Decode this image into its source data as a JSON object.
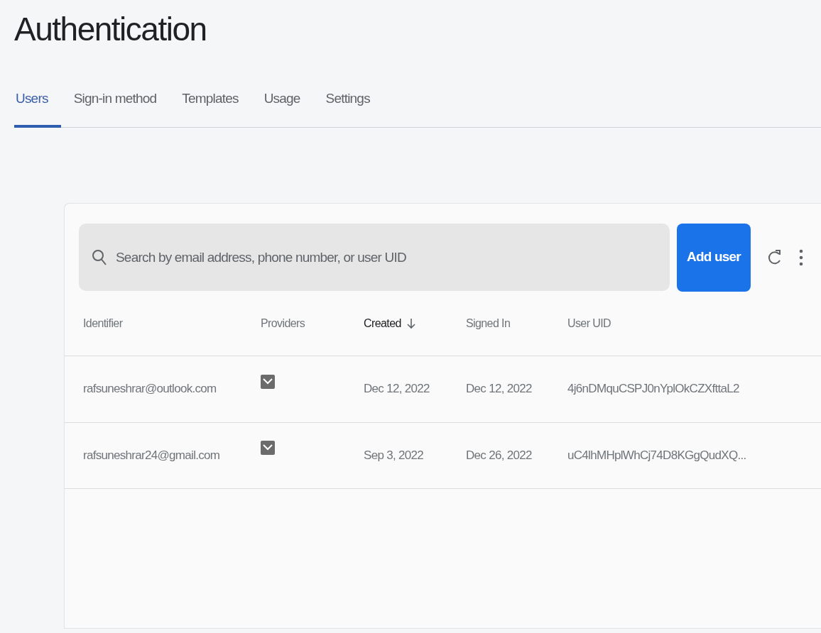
{
  "page_title": "Authentication",
  "tabs": [
    {
      "label": "Users",
      "selected": true
    },
    {
      "label": "Sign-in method",
      "selected": false
    },
    {
      "label": "Templates",
      "selected": false
    },
    {
      "label": "Usage",
      "selected": false
    },
    {
      "label": "Settings",
      "selected": false
    }
  ],
  "search": {
    "placeholder": "Search by email address, phone number, or user UID"
  },
  "add_button": "Add user",
  "table": {
    "columns": [
      {
        "label": "Identifier",
        "sorted": false
      },
      {
        "label": "Providers",
        "sorted": false
      },
      {
        "label": "Created",
        "sorted": true
      },
      {
        "label": "Signed In",
        "sorted": false
      },
      {
        "label": "User UID",
        "sorted": false
      }
    ],
    "rows": [
      {
        "identifier": "rafsuneshrar@outlook.com",
        "providers": [
          {
            "kind": "email"
          }
        ],
        "created": "Dec 12, 2022",
        "signed_in": "Dec 12, 2022",
        "uid": "4j6nDMquCSPJ0nYplOkCZXfttaL2"
      },
      {
        "identifier": "rafsuneshrar24@gmail.com",
        "providers": [
          {
            "kind": "email"
          }
        ],
        "created": "Sep 3, 2022",
        "signed_in": "Dec 26, 2022",
        "uid": "uC4lhMHplWhCj74D8KGgQudXQ..."
      }
    ]
  }
}
